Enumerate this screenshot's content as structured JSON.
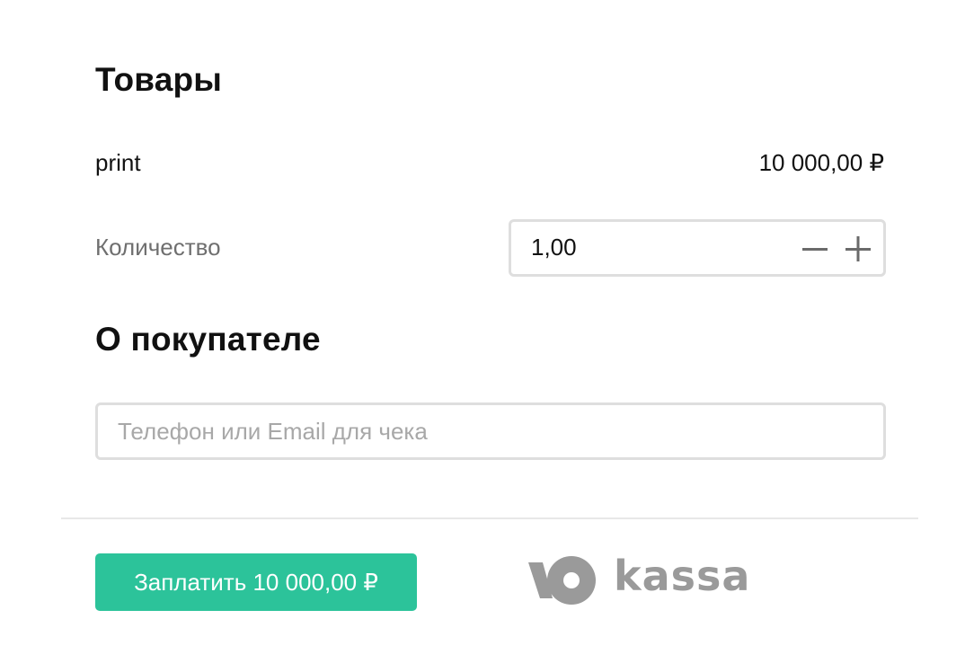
{
  "goods": {
    "title": "Товары",
    "item": {
      "name": "print",
      "price": "10 000,00 ₽"
    },
    "quantity": {
      "label": "Количество",
      "value": "1,00"
    }
  },
  "buyer": {
    "title": "О покупателе",
    "contact_placeholder": "Телефон или Email для чека",
    "contact_value": ""
  },
  "footer": {
    "pay_label": "Заплатить 10 000,00 ₽",
    "logo_text": "kassa"
  },
  "icons": {
    "minus": "minus-icon",
    "plus": "plus-icon"
  },
  "colors": {
    "accent": "#2cc39a",
    "logo": "#9a9a9a",
    "border": "#dedede",
    "muted_text": "#6f6f6f",
    "placeholder": "#a8a8a8"
  }
}
